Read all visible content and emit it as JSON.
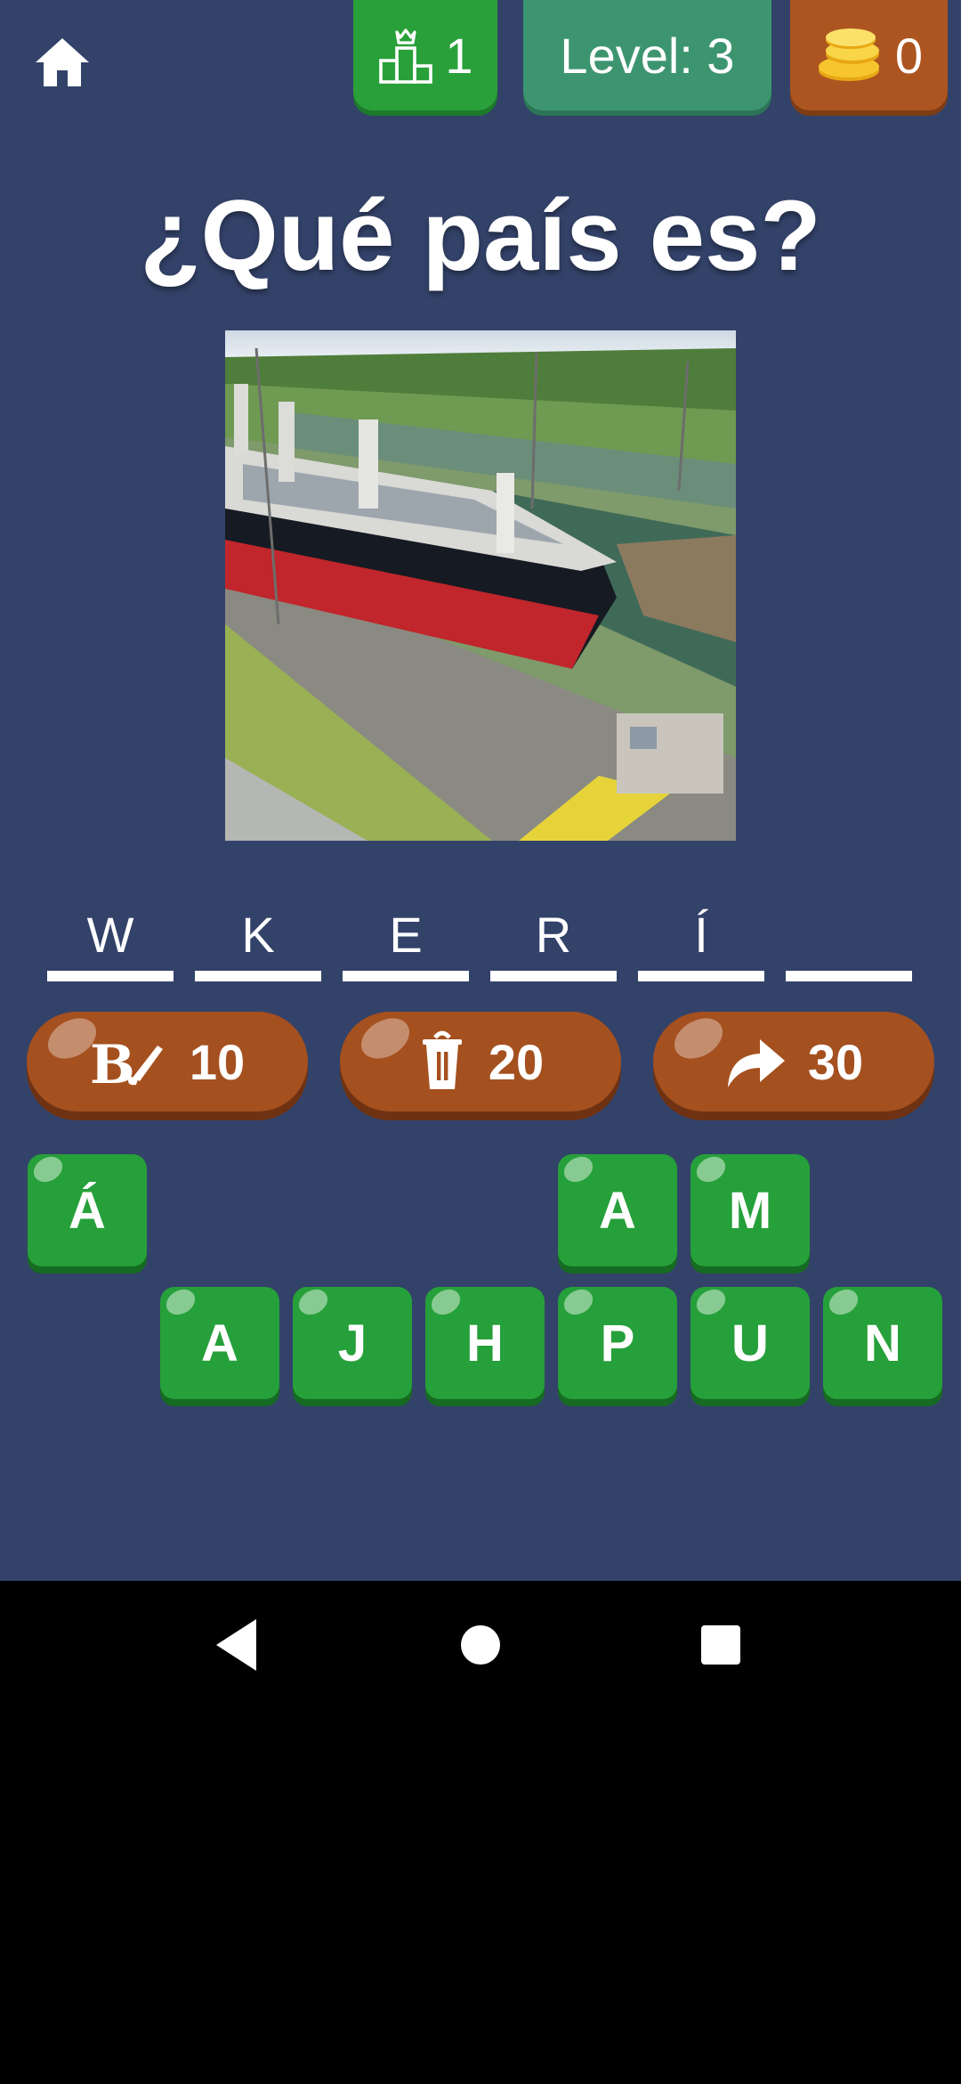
{
  "header": {
    "rank_value": "1",
    "level_label": "Level: 3",
    "coins_value": "0"
  },
  "question": "¿Qué país es?",
  "photo_alt": "Ship in canal lock",
  "answer_slots": [
    "W",
    "K",
    "E",
    "R",
    "Í",
    ""
  ],
  "hints": [
    {
      "icon": "paint-brush-icon",
      "cost": "10"
    },
    {
      "icon": "trash-bin-icon",
      "cost": "20"
    },
    {
      "icon": "skip-arrow-icon",
      "cost": "30"
    }
  ],
  "letters_row1": [
    "Á",
    "A",
    "M"
  ],
  "letters_row2": [
    "A",
    "J",
    "H",
    "P",
    "U",
    "N"
  ],
  "colors": {
    "background": "#334269",
    "tile_green": "#26a03a",
    "hint_brown": "#a5501f",
    "level_green": "#3d9570"
  }
}
